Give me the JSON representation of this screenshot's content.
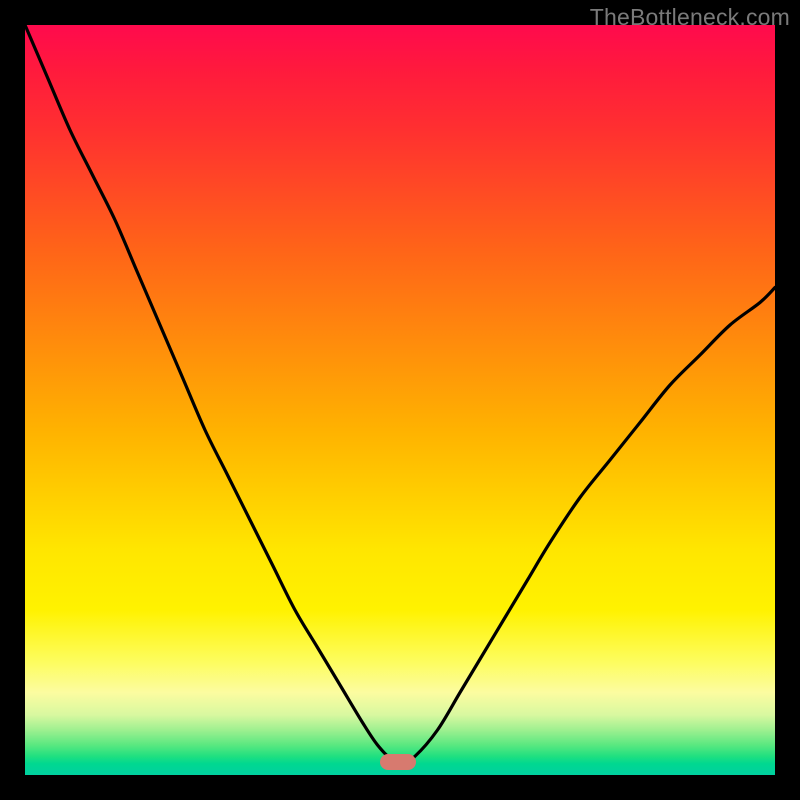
{
  "watermark": "TheBottleneck.com",
  "colors": {
    "curve_stroke": "#000000",
    "marker_fill": "#d77a6f",
    "frame_bg": "#000000"
  },
  "marker": {
    "x_frac": 0.497,
    "y_frac": 0.982
  },
  "chart_data": {
    "type": "line",
    "title": "",
    "xlabel": "",
    "ylabel": "",
    "xlim": [
      0,
      1
    ],
    "ylim": [
      0,
      1
    ],
    "series": [
      {
        "name": "curve",
        "x": [
          0.0,
          0.03,
          0.06,
          0.09,
          0.12,
          0.15,
          0.18,
          0.21,
          0.24,
          0.27,
          0.3,
          0.33,
          0.36,
          0.39,
          0.42,
          0.45,
          0.47,
          0.49,
          0.505,
          0.52,
          0.55,
          0.58,
          0.61,
          0.64,
          0.67,
          0.7,
          0.74,
          0.78,
          0.82,
          0.86,
          0.9,
          0.94,
          0.98,
          1.0
        ],
        "y": [
          1.0,
          0.93,
          0.86,
          0.8,
          0.74,
          0.67,
          0.6,
          0.53,
          0.46,
          0.4,
          0.34,
          0.28,
          0.22,
          0.17,
          0.12,
          0.07,
          0.04,
          0.02,
          0.018,
          0.025,
          0.06,
          0.11,
          0.16,
          0.21,
          0.26,
          0.31,
          0.37,
          0.42,
          0.47,
          0.52,
          0.56,
          0.6,
          0.63,
          0.65
        ]
      }
    ],
    "annotations": [
      {
        "type": "marker",
        "x": 0.497,
        "y": 0.018,
        "shape": "rounded-rect",
        "color": "#d77a6f"
      }
    ],
    "background_gradient": {
      "direction": "vertical",
      "stops": [
        {
          "pos": 0.0,
          "color": "#ff0a4d"
        },
        {
          "pos": 0.3,
          "color": "#ff7e10"
        },
        {
          "pos": 0.62,
          "color": "#ffcc00"
        },
        {
          "pos": 0.85,
          "color": "#fdfd60"
        },
        {
          "pos": 1.0,
          "color": "#00d0a0"
        }
      ]
    }
  }
}
